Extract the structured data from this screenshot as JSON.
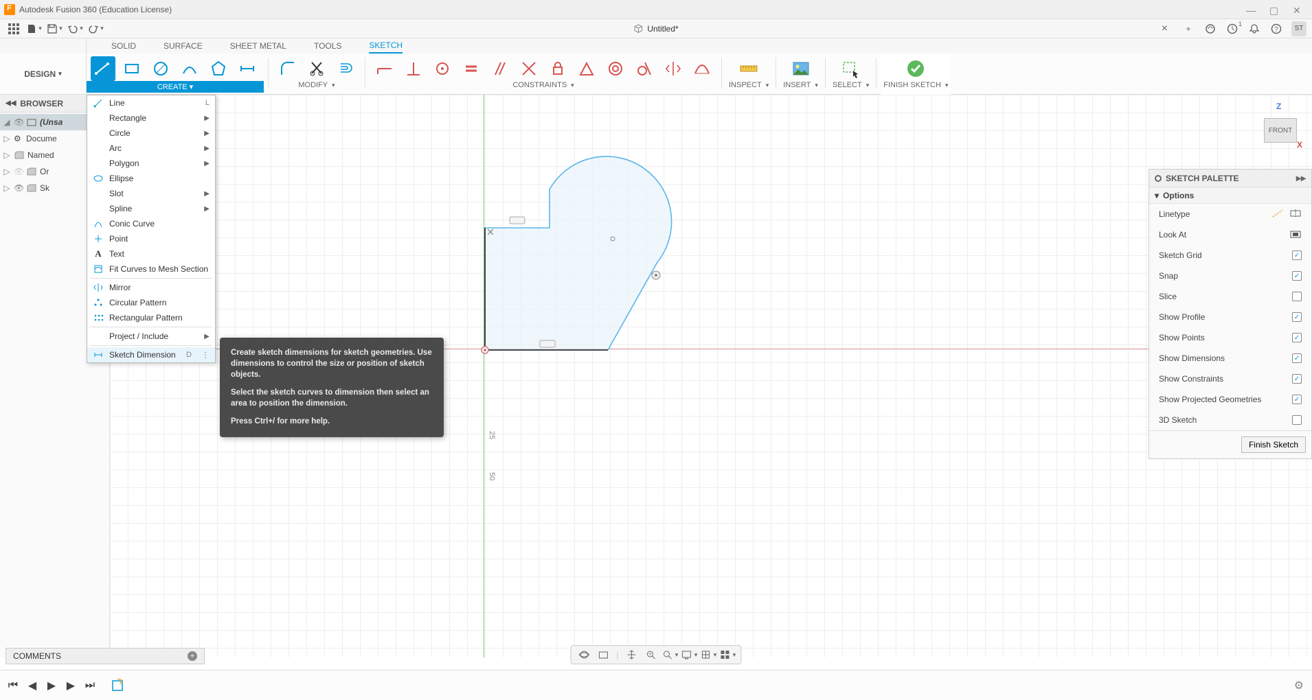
{
  "app": {
    "title": "Autodesk Fusion 360 (Education License)"
  },
  "qat": {
    "doc_title": "Untitled*",
    "job_count": "1",
    "user_initials": "ST"
  },
  "design_dropdown": "DESIGN",
  "tabs": [
    "SOLID",
    "SURFACE",
    "SHEET METAL",
    "TOOLS",
    "SKETCH"
  ],
  "active_tab": "SKETCH",
  "ribbon": {
    "create": "CREATE",
    "modify": "MODIFY",
    "constraints": "CONSTRAINTS",
    "inspect": "INSPECT",
    "insert": "INSERT",
    "select": "SELECT",
    "finish": "FINISH SKETCH"
  },
  "browser": {
    "header": "BROWSER",
    "root": "(Unsa",
    "items": [
      "Docume",
      "Named",
      "Or",
      "Sk"
    ]
  },
  "create_menu": [
    {
      "label": "Line",
      "shortcut": "L",
      "icon": "line"
    },
    {
      "label": "Rectangle",
      "sub": true
    },
    {
      "label": "Circle",
      "sub": true
    },
    {
      "label": "Arc",
      "sub": true
    },
    {
      "label": "Polygon",
      "sub": true
    },
    {
      "label": "Ellipse",
      "icon": "ellipse"
    },
    {
      "label": "Slot",
      "sub": true
    },
    {
      "label": "Spline",
      "sub": true
    },
    {
      "label": "Conic Curve",
      "icon": "conic"
    },
    {
      "label": "Point",
      "icon": "point"
    },
    {
      "label": "Text",
      "icon": "text"
    },
    {
      "label": "Fit Curves to Mesh Section",
      "icon": "fit"
    },
    {
      "label": "Mirror",
      "icon": "mirror"
    },
    {
      "label": "Circular Pattern",
      "icon": "circpattern"
    },
    {
      "label": "Rectangular Pattern",
      "icon": "rectpattern"
    },
    {
      "label": "Project / Include",
      "sub": true
    },
    {
      "label": "Sketch Dimension",
      "shortcut": "D",
      "icon": "dim",
      "highlighted": true,
      "more": true
    }
  ],
  "tooltip": {
    "p1": "Create sketch dimensions for sketch geometries. Use dimensions to control the size or position of sketch objects.",
    "p2": "Select the sketch curves to dimension then select an area to position the dimension.",
    "p3": "Press Ctrl+/ for more help."
  },
  "viewcube": {
    "z": "Z",
    "x": "X",
    "face": "FRONT"
  },
  "ruler": {
    "n25": "25",
    "n50": "50"
  },
  "palette": {
    "title": "SKETCH PALETTE",
    "section": "Options",
    "rows": [
      {
        "label": "Linetype",
        "type": "linetype"
      },
      {
        "label": "Look At",
        "type": "lookat"
      },
      {
        "label": "Sketch Grid",
        "type": "check",
        "checked": true
      },
      {
        "label": "Snap",
        "type": "check",
        "checked": true
      },
      {
        "label": "Slice",
        "type": "check",
        "checked": false
      },
      {
        "label": "Show Profile",
        "type": "check",
        "checked": true
      },
      {
        "label": "Show Points",
        "type": "check",
        "checked": true
      },
      {
        "label": "Show Dimensions",
        "type": "check",
        "checked": true
      },
      {
        "label": "Show Constraints",
        "type": "check",
        "checked": true
      },
      {
        "label": "Show Projected Geometries",
        "type": "check",
        "checked": true
      },
      {
        "label": "3D Sketch",
        "type": "check",
        "checked": false
      }
    ],
    "finish_btn": "Finish Sketch"
  },
  "comments": {
    "label": "COMMENTS"
  }
}
